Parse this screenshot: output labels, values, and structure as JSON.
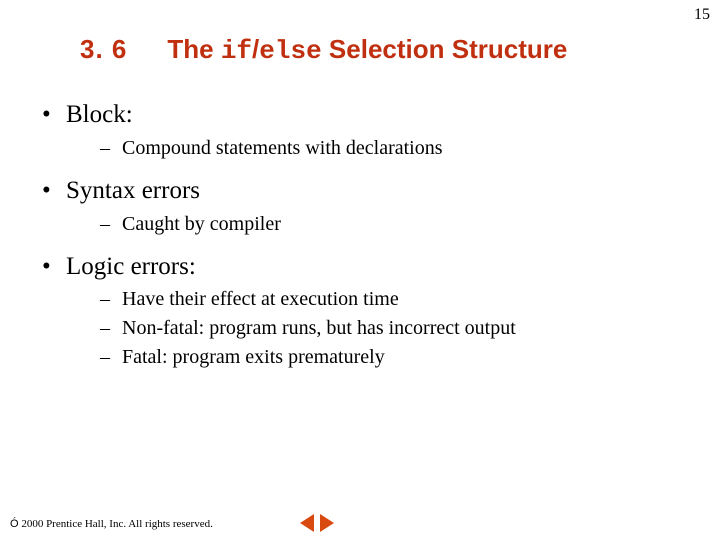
{
  "page_number": "15",
  "section_number": "3. 6",
  "title_prefix": "The ",
  "title_code1": "if",
  "title_slash": "/",
  "title_code2": "else",
  "title_suffix": " Selection Structure",
  "bullets": {
    "b1": "Block:",
    "b1_sub1": "Compound statements with declarations",
    "b2": "Syntax errors",
    "b2_sub1": "Caught by compiler",
    "b3": "Logic errors:",
    "b3_sub1": "Have their effect at execution time",
    "b3_sub2": "Non-fatal:  program runs, but has incorrect output",
    "b3_sub3": "Fatal:  program exits prematurely"
  },
  "footer_text": " 2000 Prentice Hall, Inc.  All rights reserved.",
  "copyright_symbol": "Ó"
}
